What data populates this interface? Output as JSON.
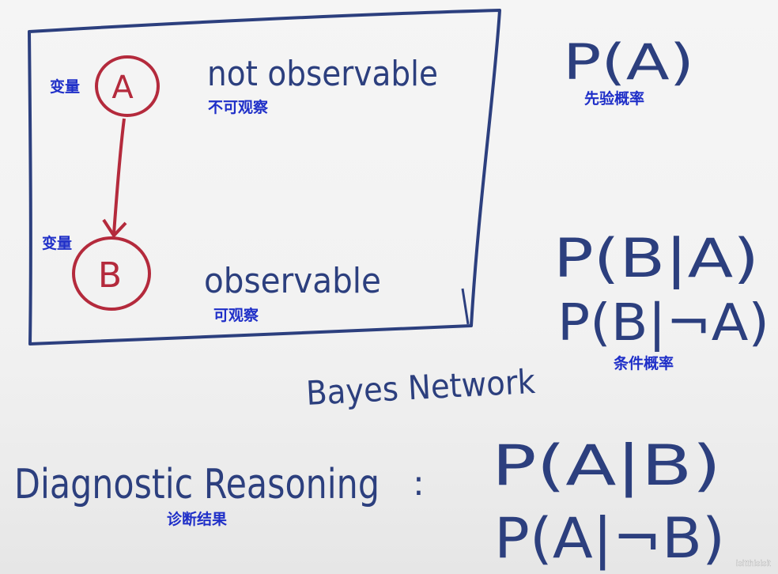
{
  "box": {
    "color": "#2c3f7e"
  },
  "nodes": {
    "a": {
      "letter": "A",
      "label_cn": "变量"
    },
    "b": {
      "letter": "B",
      "label_cn": "变量"
    },
    "color": "#b42a3c"
  },
  "texts": {
    "not_observable": "not observable",
    "not_observable_cn": "不可观察",
    "observable": "observable",
    "observable_cn": "可观察",
    "bayes_network": "Bayes Network",
    "diagnostic_reasoning": "Diagnostic Reasoning",
    "colon": ":"
  },
  "formulas": {
    "prior": "P(A)",
    "prior_cn": "先验概率",
    "cond1": "P(B|A)",
    "cond2": "P(B|¬A)",
    "cond_cn": "条件概率",
    "diag1": "P(A|B)",
    "diag2": "P(A|¬B)",
    "diag_cn": "诊断结果"
  },
  "watermark": "isitthisisit",
  "colors": {
    "ink": "#2c3f7e",
    "red_ink": "#b42a3c",
    "annotation": "#1f2fc8"
  }
}
